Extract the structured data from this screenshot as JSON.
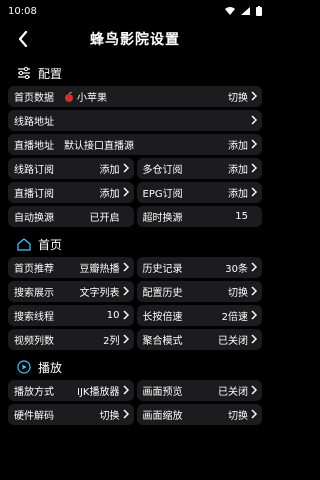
{
  "status": {
    "time": "10:08"
  },
  "header": {
    "title": "蜂鸟影院设置"
  },
  "sections": {
    "config": {
      "title": "配置"
    },
    "home": {
      "title": "首页"
    },
    "play": {
      "title": "播放"
    }
  },
  "config": {
    "home_data": {
      "label": "首页数据",
      "source": "小苹果",
      "action": "切换"
    },
    "line_addr": {
      "label": "线路地址"
    },
    "live_addr": {
      "label": "直播地址",
      "desc": "默认接口直播源",
      "action": "添加"
    },
    "line_sub": {
      "label": "线路订阅",
      "action": "添加"
    },
    "multi_sub": {
      "label": "多仓订阅",
      "action": "添加"
    },
    "live_sub": {
      "label": "直播订阅",
      "action": "添加"
    },
    "epg_sub": {
      "label": "EPG订阅",
      "action": "添加"
    },
    "auto_switch": {
      "label": "自动换源",
      "value": "已开启"
    },
    "timeout_switch": {
      "label": "超时换源",
      "value": "15"
    }
  },
  "home": {
    "recommend": {
      "label": "首页推荐",
      "value": "豆瓣热播"
    },
    "history": {
      "label": "历史记录",
      "value": "30条"
    },
    "search_display": {
      "label": "搜索展示",
      "value": "文字列表"
    },
    "config_history": {
      "label": "配置历史",
      "value": "切换"
    },
    "search_threads": {
      "label": "搜索线程",
      "value": "10"
    },
    "long_press_speed": {
      "label": "长按倍速",
      "value": "2倍速"
    },
    "video_columns": {
      "label": "视频列数",
      "value": "2列"
    },
    "aggregate_mode": {
      "label": "聚合模式",
      "value": "已关闭"
    }
  },
  "play": {
    "method": {
      "label": "播放方式",
      "value": "IJK播放器"
    },
    "preview": {
      "label": "画面预览",
      "value": "已关闭"
    },
    "decode": {
      "label": "硬件解码",
      "value": "切换"
    },
    "scale": {
      "label": "画面缩放",
      "value": "切换"
    }
  },
  "colors": {
    "background": "#000000",
    "card": "#1c1c1e",
    "accent": "#ffffff"
  },
  "icons": [
    "back-arrow-icon",
    "sliders-icon",
    "home-icon",
    "play-circle-icon",
    "chevron-right-icon",
    "apple-icon"
  ]
}
